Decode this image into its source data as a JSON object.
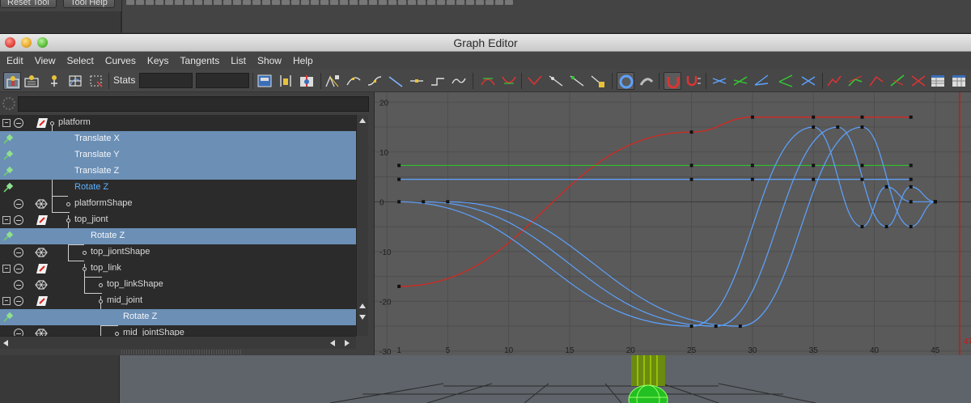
{
  "host": {
    "buttons": [
      "Reset Tool",
      "Tool Help"
    ]
  },
  "window": {
    "title": "Graph Editor"
  },
  "menu": [
    "Edit",
    "View",
    "Select",
    "Curves",
    "Keys",
    "Tangents",
    "List",
    "Show",
    "Help"
  ],
  "toolbar": {
    "stats_label": "Stats",
    "stats_value_1": "",
    "stats_value_2": ""
  },
  "outliner": {
    "filter_value": "",
    "rows": [
      {
        "label": "platform",
        "kind": "transform",
        "selected": false
      },
      {
        "label": "Translate X",
        "kind": "attribute",
        "selected": true
      },
      {
        "label": "Translate Y",
        "kind": "attribute",
        "selected": true
      },
      {
        "label": "Translate Z",
        "kind": "attribute",
        "selected": true
      },
      {
        "label": "Rotate Z",
        "kind": "attribute",
        "selected": false
      },
      {
        "label": "platformShape",
        "kind": "shape",
        "selected": false
      },
      {
        "label": "top_jiont",
        "kind": "transform",
        "selected": false
      },
      {
        "label": "Rotate Z",
        "kind": "attribute",
        "selected": true
      },
      {
        "label": "top_jiontShape",
        "kind": "shape",
        "selected": false
      },
      {
        "label": "top_link",
        "kind": "transform",
        "selected": false
      },
      {
        "label": "top_linkShape",
        "kind": "shape",
        "selected": false
      },
      {
        "label": "mid_joint",
        "kind": "transform",
        "selected": false
      },
      {
        "label": "Rotate Z",
        "kind": "attribute",
        "selected": true
      },
      {
        "label": "mid_jointShape",
        "kind": "shape",
        "selected": false
      }
    ]
  },
  "chart_data": {
    "type": "line",
    "xlim": [
      -1,
      48
    ],
    "ylim": [
      -31,
      22
    ],
    "x_ticks": [
      1,
      5,
      10,
      15,
      20,
      25,
      30,
      35,
      40,
      45
    ],
    "y_ticks": [
      20,
      10,
      0,
      -10,
      -20,
      -30
    ],
    "current_frame": 47,
    "colors": {
      "red": "#e0241c",
      "green": "#2fbf2f",
      "blue": "#5da2ff",
      "current_time": "#d31010"
    },
    "series": [
      {
        "color": "red",
        "keys": [
          [
            1,
            -17
          ],
          [
            25,
            14
          ],
          [
            30,
            17
          ],
          [
            35,
            17
          ],
          [
            39,
            17
          ],
          [
            43,
            17
          ]
        ]
      },
      {
        "color": "green",
        "keys": [
          [
            1,
            7.3
          ],
          [
            25,
            7.3
          ],
          [
            30,
            7.3
          ],
          [
            35,
            7.3
          ],
          [
            39,
            7.3
          ],
          [
            43,
            7.3
          ]
        ]
      },
      {
        "color": "blue",
        "keys": [
          [
            1,
            4.5
          ],
          [
            25,
            4.5
          ],
          [
            30,
            4.5
          ],
          [
            35,
            4.5
          ],
          [
            39,
            4.5
          ],
          [
            43,
            4.5
          ]
        ]
      },
      {
        "color": "blue",
        "keys": [
          [
            1,
            0
          ],
          [
            25,
            -25
          ],
          [
            35,
            15
          ],
          [
            39,
            -5
          ],
          [
            41,
            3
          ],
          [
            43,
            0
          ],
          [
            45,
            0
          ]
        ]
      },
      {
        "color": "blue",
        "keys": [
          [
            3,
            0
          ],
          [
            27,
            -25
          ],
          [
            37,
            15
          ],
          [
            41,
            -5
          ],
          [
            43,
            3
          ],
          [
            45,
            0
          ]
        ]
      },
      {
        "color": "blue",
        "keys": [
          [
            5,
            0
          ],
          [
            29,
            -25
          ],
          [
            39,
            15
          ],
          [
            43,
            -5
          ],
          [
            45,
            0
          ]
        ]
      }
    ]
  }
}
